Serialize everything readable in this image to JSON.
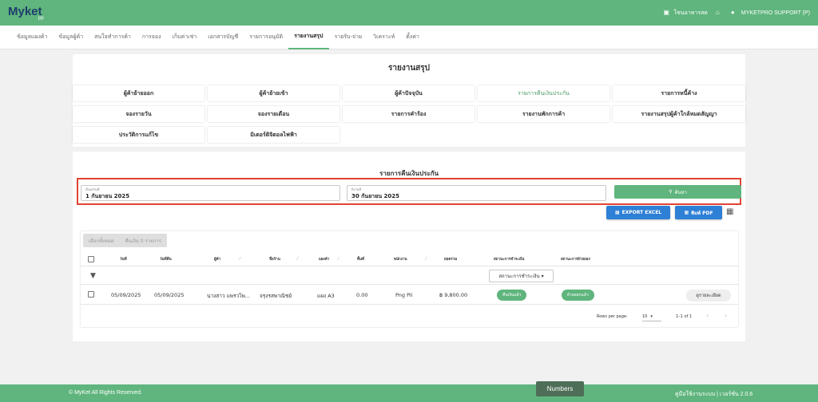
{
  "app": {
    "logo_main": "Myket",
    "logo_sub": "pp",
    "store_name": "โซนอาหารสด",
    "user_name": "MYKETPRO SUPPORT (P)"
  },
  "nav": {
    "items": [
      {
        "label": "ข้อมูลแผงค้า",
        "active": false
      },
      {
        "label": "ข้อมูลผู้ค้า",
        "active": false
      },
      {
        "label": "สนใจทำการค้า",
        "active": false
      },
      {
        "label": "การจอง",
        "active": false
      },
      {
        "label": "เก็บค่าเช่า",
        "active": false
      },
      {
        "label": "เอกสารบัญชี",
        "active": false
      },
      {
        "label": "รายการอนุมัติ",
        "active": false
      },
      {
        "label": "รายงานสรุป",
        "active": true
      },
      {
        "label": "รายรับ-จ่าย",
        "active": false
      },
      {
        "label": "วิเคราะห์",
        "active": false
      },
      {
        "label": "ตั้งค่า",
        "active": false
      }
    ]
  },
  "report": {
    "title": "รายงานสรุป",
    "buttons": [
      {
        "label": "ผู้ค้าย้ายออก",
        "active": false
      },
      {
        "label": "ผู้ค้าย้ายเข้า",
        "active": false
      },
      {
        "label": "ผู้ค้าปัจจุบัน",
        "active": false
      },
      {
        "label": "รายการคืนเงินประกัน",
        "active": true
      },
      {
        "label": "รายการหนี้ค้าง",
        "active": false
      },
      {
        "label": "จองรายวัน",
        "active": false
      },
      {
        "label": "จองรายเดือน",
        "active": false
      },
      {
        "label": "รายการคำร้อง",
        "active": false
      },
      {
        "label": "รายงานพักการค้า",
        "active": false
      },
      {
        "label": "รายงานสรุปผู้ค้าใกล้หมดสัญญา",
        "active": false
      },
      {
        "label": "ประวัติการแก้ไข",
        "active": false
      },
      {
        "label": "มิเตอร์ดิจิตอลไฟฟ้า",
        "active": false
      }
    ]
  },
  "refund": {
    "title": "รายการคืนเงินประกัน",
    "from_label": "ตั้งแต่วันที่",
    "from_value": "1 กันยายน 2025",
    "to_label": "ถึงวันที่",
    "to_value": "30 กันยายน 2025",
    "search_label": "ค้นหา",
    "export_excel": "EXPORT EXCEL",
    "print_pdf": "พิมพ์ PDF"
  },
  "table": {
    "select_all": "เลือกทั้งหมด",
    "refund_selected": "คืนเงิน 0 รายการ",
    "headers": [
      "วันที่",
      "วันที่คืน",
      "ผู้ค้า",
      "ชื่อร้าน",
      "แผงค้า",
      "พื้นที่",
      "พนักงาน",
      "ยอดรวม",
      "สถานะการชำระเงิน",
      "สถานะการย้ายออก"
    ],
    "status_filter": "สถานะการชำระเงิน",
    "rows": [
      {
        "date": "05/09/2025",
        "return_date": "05/09/2025",
        "vendor": "นางสาว แพรวไพ...",
        "shop": "จรุงรสพาณิชย์",
        "stall": "แผง A3",
        "area": "0.00",
        "staff": "Png Pii",
        "total": "฿ 9,800.00",
        "payment_status": "คืนเงินแล้ว",
        "move_status": "ย้ายออกแล้ว",
        "detail": "ดูรายละเอียด"
      }
    ],
    "rows_per_page_label": "Rows per page:",
    "rows_per_page": "10",
    "range": "1–1 of 1"
  },
  "footer": {
    "copyright": "© MyKet All Rights Reserved.",
    "right": "คู่มือใช้งานระบบ | เวอร์ชั่น 2.0.6",
    "numbers_tab": "Numbers"
  },
  "colors": {
    "primary": "#5fb57d",
    "blue": "#2e7fd6",
    "highlight": "#e04333"
  }
}
